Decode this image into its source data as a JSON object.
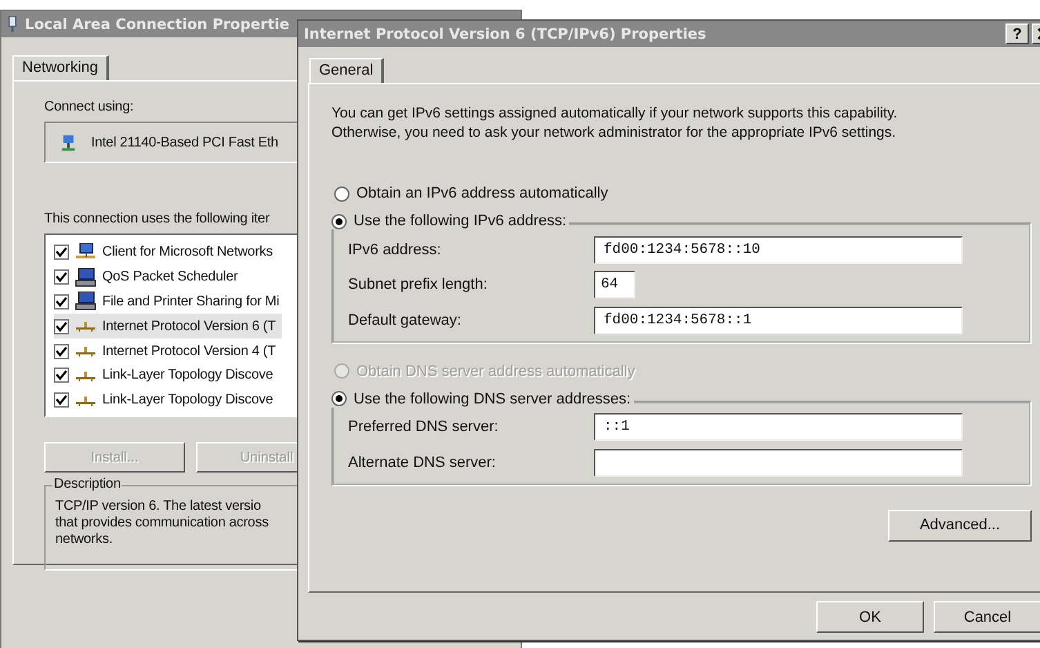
{
  "background_window": {
    "title": "Local Area Connection Propertie",
    "tabs": [
      {
        "label": "Networking",
        "selected": true
      }
    ],
    "connect_using_label": "Connect using:",
    "adapter": "Intel 21140-Based PCI Fast Eth",
    "components_label": "This connection uses the following iter",
    "components": [
      {
        "label": "Client for Microsoft Networks",
        "kind": "client",
        "checked": true,
        "selected": false
      },
      {
        "label": "QoS Packet Scheduler",
        "kind": "service",
        "checked": true,
        "selected": false
      },
      {
        "label": "File and Printer Sharing for Mi",
        "kind": "service",
        "checked": true,
        "selected": false
      },
      {
        "label": "Internet Protocol Version 6 (T",
        "kind": "protocol",
        "checked": true,
        "selected": true
      },
      {
        "label": "Internet Protocol Version 4 (T",
        "kind": "protocol",
        "checked": true,
        "selected": false
      },
      {
        "label": "Link-Layer Topology Discove",
        "kind": "protocol",
        "checked": true,
        "selected": false
      },
      {
        "label": "Link-Layer Topology Discove",
        "kind": "protocol",
        "checked": true,
        "selected": false
      }
    ],
    "buttons": [
      {
        "label": "Install...",
        "disabled": true
      },
      {
        "label": "Uninstall",
        "disabled": true
      }
    ],
    "description": {
      "legend": "Description",
      "lines": [
        "TCP/IP version 6. The latest versio",
        "that provides communication across",
        "networks."
      ]
    }
  },
  "dialog": {
    "title": "Internet Protocol Version 6 (TCP/IPv6) Properties",
    "help_button": "?",
    "tabs": [
      {
        "label": "General",
        "selected": true
      }
    ],
    "intro": [
      "You can get IPv6 settings assigned automatically if your network supports this capability.",
      "Otherwise, you need to ask your network administrator for the appropriate IPv6 settings."
    ],
    "address_auto": {
      "label": "Obtain an IPv6 address automatically",
      "selected": false,
      "disabled": false
    },
    "address_manual": {
      "label": "Use the following IPv6 address:",
      "selected": true,
      "disabled": false,
      "fields": [
        {
          "label": "IPv6 address:",
          "value": "fd00:1234:5678::10",
          "kind": "wide"
        },
        {
          "label": "Subnet prefix length:",
          "value": "64",
          "kind": "short"
        },
        {
          "label": "Default gateway:",
          "value": "fd00:1234:5678::1",
          "kind": "wide"
        }
      ]
    },
    "dns_auto": {
      "label": "Obtain DNS server address automatically",
      "selected": false,
      "disabled": true
    },
    "dns_manual": {
      "label": "Use the following DNS server addresses:",
      "selected": true,
      "disabled": false,
      "fields": [
        {
          "label": "Preferred DNS server:",
          "value": "::1"
        },
        {
          "label": "Alternate DNS server:"
        }
      ]
    },
    "advanced_button": "Advanced...",
    "buttons": [
      "OK",
      "Cancel"
    ]
  }
}
